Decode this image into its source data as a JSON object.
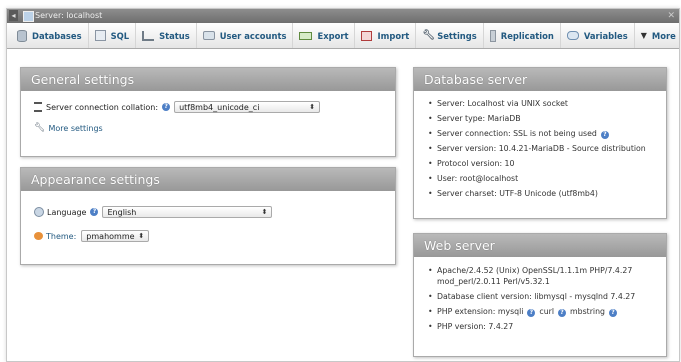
{
  "window": {
    "title": "Server: localhost",
    "close_glyph": "✕"
  },
  "tabs": [
    {
      "label": "Databases",
      "icon": "database-icon"
    },
    {
      "label": "SQL",
      "icon": "sql-icon"
    },
    {
      "label": "Status",
      "icon": "status-icon"
    },
    {
      "label": "User accounts",
      "icon": "users-icon"
    },
    {
      "label": "Export",
      "icon": "export-icon"
    },
    {
      "label": "Import",
      "icon": "import-icon"
    },
    {
      "label": "Settings",
      "icon": "wrench-icon"
    },
    {
      "label": "Replication",
      "icon": "replication-icon"
    },
    {
      "label": "Variables",
      "icon": "variables-icon"
    },
    {
      "label": "More",
      "icon": "chevron-down-icon"
    }
  ],
  "general": {
    "title": "General settings",
    "collation_label": "Server connection collation:",
    "collation_value": "utf8mb4_unicode_ci",
    "more_settings": "More settings"
  },
  "appearance": {
    "title": "Appearance settings",
    "language_label": "Language",
    "language_value": "English",
    "theme_label": "Theme:",
    "theme_value": "pmahomme"
  },
  "dbserver": {
    "title": "Database server",
    "items": [
      "Server: Localhost via UNIX socket",
      "Server type: MariaDB",
      "Server connection: SSL is not being used",
      "Server version: 10.4.21-MariaDB - Source distribution",
      "Protocol version: 10",
      "User: root@localhost",
      "Server charset: UTF-8 Unicode (utf8mb4)"
    ]
  },
  "webserver": {
    "title": "Web server",
    "items": [
      "Apache/2.4.52 (Unix) OpenSSL/1.1.1m PHP/7.4.27 mod_perl/2.0.11 Perl/v5.32.1",
      "Database client version: libmysql - mysqlnd 7.4.27",
      "PHP extension: mysqli",
      "PHP version: 7.4.27"
    ],
    "ext_curl": "curl",
    "ext_mbstring": "mbstring"
  },
  "colors": {
    "link": "#235a81",
    "panel_header": "#a8a8a8",
    "help_icon": "#4d7fc6"
  }
}
